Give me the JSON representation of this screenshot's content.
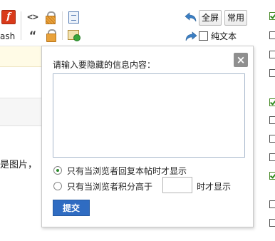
{
  "toolbar": {
    "flash_label": "ash",
    "fullscreen_label": "全屏",
    "common_label": "常用",
    "plain_text_label": "纯文本",
    "icons": {
      "flash": "flash-icon",
      "code": "code-icon",
      "quote": "quote-icon",
      "hide": "hide-content-icon",
      "pay": "pay-to-view-icon",
      "doc": "document-icon",
      "image": "image-icon",
      "undo": "undo-arrow-icon",
      "redo": "redo-arrow-icon"
    }
  },
  "background": {
    "partial_text": "是图片，"
  },
  "popup": {
    "title": "请输入要隐藏的信息内容：",
    "close_symbol": "×",
    "content_value": "",
    "option_reply_label": "只有当浏览者回复本帖时才显示",
    "option_points_prefix": "只有当浏览者积分高于",
    "option_points_suffix": "时才显示",
    "points_value": "",
    "selected_option": "reply",
    "submit_label": "提交"
  },
  "right_checkboxes": [
    true,
    false,
    false,
    false,
    true,
    false,
    false,
    false,
    true,
    false,
    false
  ]
}
